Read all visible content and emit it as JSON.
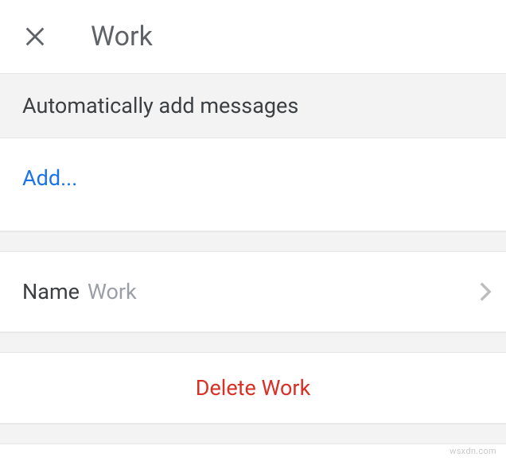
{
  "header": {
    "title": "Work"
  },
  "section": {
    "auto_add_label": "Automatically add messages",
    "add_label": "Add..."
  },
  "name": {
    "label": "Name",
    "value": "Work"
  },
  "delete": {
    "label": "Delete Work"
  },
  "watermark": "wsxdn.com"
}
